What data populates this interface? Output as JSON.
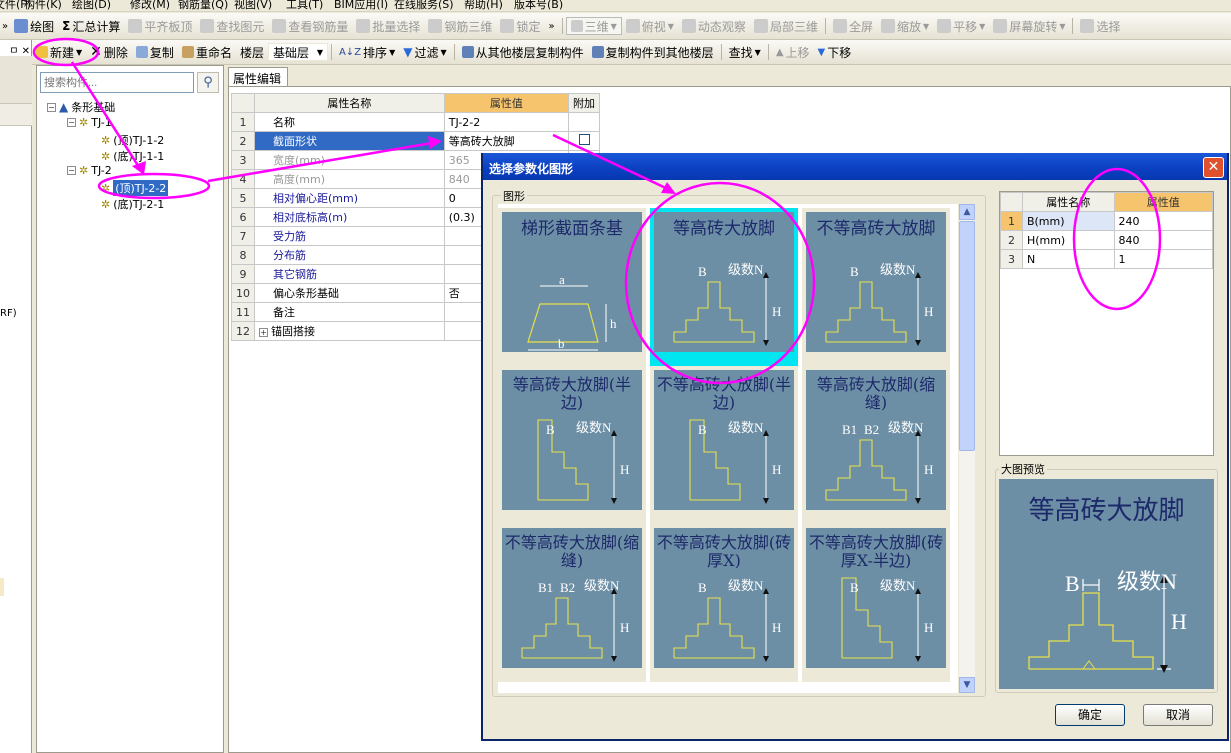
{
  "menu": [
    "文件(F)",
    "构件(K)",
    "绘图(D)",
    "修改(M)",
    "钢筋量(Q)",
    "视图(V)",
    "工具(T)",
    "BIM应用(I)",
    "在线服务(S)",
    "帮助(H)",
    "版本号(B)"
  ],
  "toolbar1": {
    "draw": "绘图",
    "sum": "汇总计算",
    "flat_roof": "平齐板顶",
    "find": "查找图元",
    "view_rebar": "查看钢筋量",
    "batch_select": "批量选择",
    "rebar_3d": "钢筋三维",
    "lock": "锁定",
    "view_3d": "三维",
    "plan_view": "俯视",
    "dynamic": "动态观察",
    "partial_3d": "局部三维",
    "fullscreen": "全屏",
    "zoom": "缩放",
    "pan": "平移",
    "rotate": "屏幕旋转",
    "select": "选择"
  },
  "toolbar2": {
    "new": "新建",
    "delete": "删除",
    "copy": "复制",
    "rename": "重命名",
    "floor_label": "楼层",
    "floor_value": "基础层",
    "sort": "排序",
    "filter": "过滤",
    "copy_from": "从其他楼层复制构件",
    "copy_to": "复制构件到其他楼层",
    "find": "查找",
    "up": "上移",
    "down": "下移"
  },
  "tree": {
    "search_placeholder": "搜索构件...",
    "root": "条形基础",
    "groups": [
      {
        "name": "TJ-1",
        "children": [
          "(顶)TJ-1-2",
          "(底)TJ-1-1"
        ]
      },
      {
        "name": "TJ-2",
        "children": [
          "(顶)TJ-2-2",
          "(底)TJ-2-1"
        ]
      }
    ],
    "selected": "(顶)TJ-2-2",
    "side_text": "RF)"
  },
  "props": {
    "tab": "属性编辑",
    "headers": [
      "属性名称",
      "属性值",
      "附加"
    ],
    "rows": [
      {
        "n": "1",
        "name": "名称",
        "value": "TJ-2-2"
      },
      {
        "n": "2",
        "name": "截面形状",
        "value": "等高砖大放脚"
      },
      {
        "n": "3",
        "name": "宽度(mm)",
        "value": "365"
      },
      {
        "n": "4",
        "name": "高度(mm)",
        "value": "840"
      },
      {
        "n": "5",
        "name": "相对偏心距(mm)",
        "value": "0"
      },
      {
        "n": "6",
        "name": "相对底标高(m)",
        "value": "(0.3)"
      },
      {
        "n": "7",
        "name": "受力筋",
        "value": ""
      },
      {
        "n": "8",
        "name": "分布筋",
        "value": ""
      },
      {
        "n": "9",
        "name": "其它钢筋",
        "value": ""
      },
      {
        "n": "10",
        "name": "偏心条形基础",
        "value": "否"
      },
      {
        "n": "11",
        "name": "备注",
        "value": ""
      },
      {
        "n": "12",
        "name": "锚固搭接",
        "value": ""
      }
    ]
  },
  "dialog": {
    "title": "选择参数化图形",
    "group_label": "图形",
    "shapes": [
      {
        "title": "梯形截面条基",
        "labels": [
          "a",
          "h",
          "b"
        ]
      },
      {
        "title": "等高砖大放脚",
        "labels": [
          "B",
          "级数N",
          "H"
        ]
      },
      {
        "title": "不等高砖大放脚",
        "labels": [
          "B",
          "级数N",
          "H"
        ]
      },
      {
        "title": "等高砖大放脚(半边)",
        "labels": [
          "B",
          "级数N",
          "H"
        ]
      },
      {
        "title": "不等高砖大放脚(半边)",
        "labels": [
          "B",
          "级数N",
          "H"
        ]
      },
      {
        "title": "等高砖大放脚(缩缝)",
        "labels": [
          "B1",
          "B2",
          "级数N",
          "H"
        ]
      },
      {
        "title": "不等高砖大放脚(缩缝)",
        "labels": [
          "B1",
          "B2",
          "级数N",
          "H"
        ]
      },
      {
        "title": "不等高砖大放脚(砖厚X)",
        "labels": [
          "B",
          "级数N",
          "H"
        ]
      },
      {
        "title": "不等高砖大放脚(砖厚X-半边)",
        "labels": [
          "B",
          "级数N",
          "H"
        ]
      }
    ],
    "selected_index": 1,
    "param_headers": [
      "属性名称",
      "属性值"
    ],
    "params": [
      {
        "n": "1",
        "name": "B(mm)",
        "value": "240"
      },
      {
        "n": "2",
        "name": "H(mm)",
        "value": "840"
      },
      {
        "n": "3",
        "name": "N",
        "value": "1"
      }
    ],
    "preview_label": "大图预览",
    "preview": {
      "title": "等高砖大放脚",
      "b": "B",
      "n": "级数N",
      "h": "H"
    },
    "ok": "确定",
    "cancel": "取消"
  },
  "colors": {
    "annotation": "#ff00ff",
    "selection": "#316ac5",
    "card": "#6d8fa6",
    "highlight": "#00e6f0",
    "header_value": "#f5c46c"
  }
}
